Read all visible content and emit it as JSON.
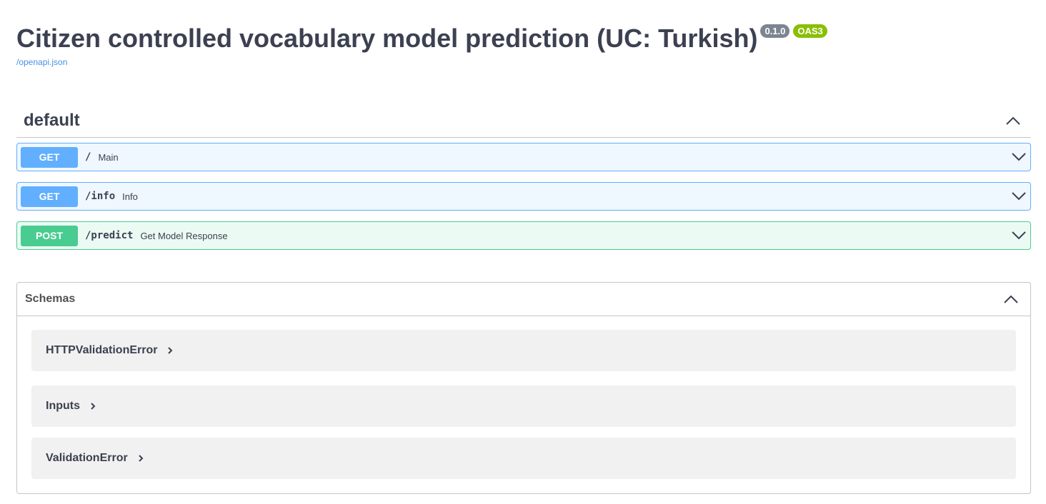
{
  "info": {
    "title": "Citizen controlled vocabulary model prediction (UC: Turkish)",
    "version_badge": "0.1.0",
    "oas_badge": "OAS3",
    "spec_link": "/openapi.json"
  },
  "tag": {
    "name": "default",
    "expanded": true
  },
  "operations": [
    {
      "method": "GET",
      "path": "/",
      "summary": "Main"
    },
    {
      "method": "GET",
      "path": "/info",
      "summary": "Info"
    },
    {
      "method": "POST",
      "path": "/predict",
      "summary": "Get Model Response"
    }
  ],
  "schemas": {
    "title": "Schemas",
    "models": [
      {
        "name": "HTTPValidationError"
      },
      {
        "name": "Inputs"
      },
      {
        "name": "ValidationError"
      }
    ]
  },
  "colors": {
    "get": "#61affe",
    "post": "#49cc90",
    "version_badge": "#7d8492",
    "oas_badge": "#89bf04",
    "link": "#4990e2"
  }
}
